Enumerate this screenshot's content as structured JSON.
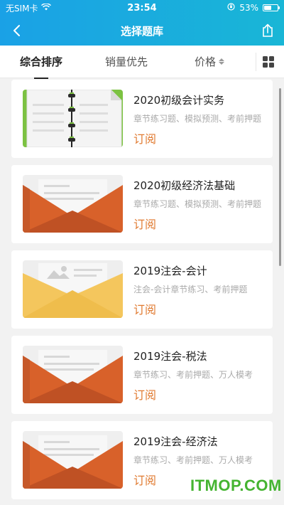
{
  "status_bar": {
    "carrier": "无SIM卡",
    "time": "23:54",
    "battery": "53%",
    "battery_level": 0.53
  },
  "nav": {
    "title": "选择题库",
    "back_icon": "chevron-left-icon",
    "share_icon": "share-icon"
  },
  "tabs": {
    "comprehensive": "综合排序",
    "sales": "销量优先",
    "price": "价格",
    "grid_icon": "grid-view-icon"
  },
  "cards": [
    {
      "title": "2020初级会计实务",
      "desc": "章节练习题、模拟预测、考前押题",
      "action": "订阅",
      "thumb": "notebook"
    },
    {
      "title": "2020初级经济法基础",
      "desc": "章节练习题、模拟预测、考前押题",
      "action": "订阅",
      "thumb": "envelope-orange"
    },
    {
      "title": "2019注会-会计",
      "desc": "注会-会计章节练习、考前押题",
      "action": "订阅",
      "thumb": "envelope-yellow"
    },
    {
      "title": "2019注会-税法",
      "desc": "章节练习、考前押题、万人模考",
      "action": "订阅",
      "thumb": "envelope-orange"
    },
    {
      "title": "2019注会-经济法",
      "desc": "章节练习、考前押题、万人模考",
      "action": "订阅",
      "thumb": "envelope-orange"
    }
  ],
  "watermark": "ITMOP.COM",
  "colors": {
    "accent": "#1aa1e6",
    "action": "#e07a30",
    "watermark": "#45b431"
  }
}
